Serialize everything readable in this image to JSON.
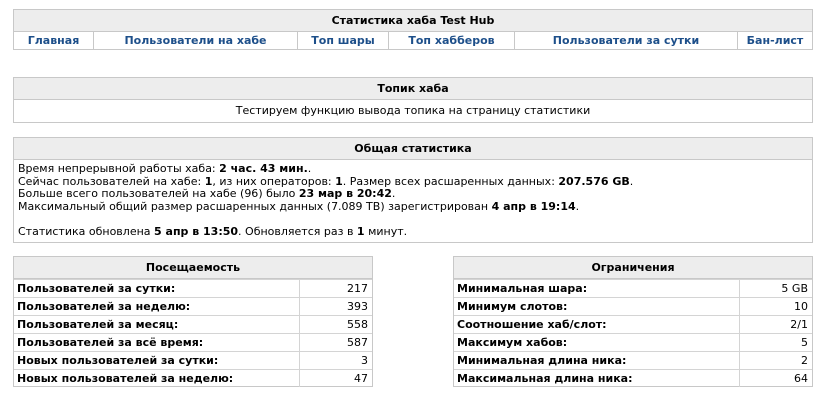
{
  "header": {
    "title": "Статистика хаба Test Hub",
    "nav": [
      "Главная",
      "Пользователи на хабе",
      "Топ шары",
      "Топ хабберов",
      "Пользователи за сутки",
      "Бан-лист"
    ]
  },
  "topic": {
    "title": "Топик хаба",
    "text": "Тестируем функцию вывода топика на страницу статистики"
  },
  "stats": {
    "title": "Общая статистика",
    "uptime_label": "Время непрерывной работы хаба: ",
    "uptime_value": "2 час. 43 мин.",
    "uptime_suffix": ".",
    "users_label": "Сейчас пользователей на хабе: ",
    "users_value": "1",
    "ops_label": ", из них операторов: ",
    "ops_value": "1",
    "share_label": ". Размер всех расшаренных данных: ",
    "share_value": "207.576 GB",
    "share_suffix": ".",
    "max_users_label": "Больше всего пользователей на хабе (",
    "max_users_value": "96",
    "max_users_mid": ") было ",
    "max_users_date": "23 мар в 20:42",
    "max_users_suffix": ".",
    "max_share_label": "Максимальный общий размер расшаренных данных (",
    "max_share_value": "7.089 TB",
    "max_share_mid": ") зарегистрирован ",
    "max_share_date": "4 апр в 19:14",
    "max_share_suffix": ".",
    "updated_label": "Статистика обновлена ",
    "updated_value": "5 апр в 13:50",
    "updated_mid": ". Обновляется раз в ",
    "updated_interval": "1",
    "updated_suffix": " минут."
  },
  "visits": {
    "title": "Посещаемость",
    "rows": [
      {
        "label": "Пользователей за сутки:",
        "value": "217"
      },
      {
        "label": "Пользователей за неделю:",
        "value": "393"
      },
      {
        "label": "Пользователей за месяц:",
        "value": "558"
      },
      {
        "label": "Пользователей за всё время:",
        "value": "587"
      },
      {
        "label": "Новых пользователей за сутки:",
        "value": "3"
      },
      {
        "label": "Новых пользователей за неделю:",
        "value": "47"
      }
    ]
  },
  "limits": {
    "title": "Ограничения",
    "rows": [
      {
        "label": "Минимальная шара:",
        "value": "5 GB"
      },
      {
        "label": "Минимум слотов:",
        "value": "10"
      },
      {
        "label": "Соотношение хаб/слот:",
        "value": "2/1"
      },
      {
        "label": "Максимум хабов:",
        "value": "5"
      },
      {
        "label": "Минимальная длина ника:",
        "value": "2"
      },
      {
        "label": "Максимальная длина ника:",
        "value": "64"
      }
    ]
  },
  "footer": {
    "text": "                              "
  }
}
